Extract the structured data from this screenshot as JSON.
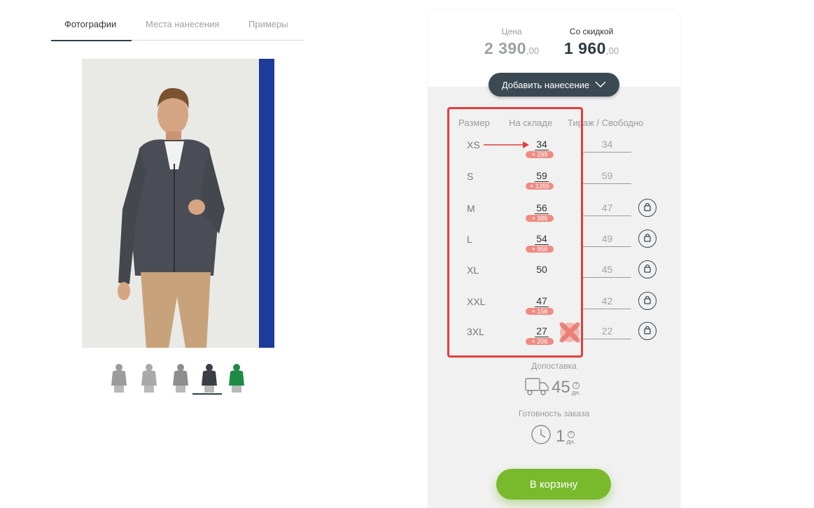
{
  "gallery": {
    "tabs": [
      {
        "label": "Фотографии",
        "active": true
      },
      {
        "label": "Места нанесения",
        "active": false
      },
      {
        "label": "Примеры",
        "active": false
      }
    ],
    "thumbnails": [
      {
        "color": "#9c9c9c",
        "active": false
      },
      {
        "color": "#a9a9a9",
        "active": false
      },
      {
        "color": "#8e8e8e",
        "active": false
      },
      {
        "color": "#3a3f47",
        "active": true
      },
      {
        "color": "#1f8a43",
        "active": false
      }
    ]
  },
  "prices": {
    "base_label": "Цена",
    "base_value": "2 390",
    "base_cents": ",00",
    "discount_label": "Со скидкой",
    "discount_value": "1 960",
    "discount_cents": ",00"
  },
  "add_print_button": {
    "label": "Добавить нанесение"
  },
  "table": {
    "headers": {
      "size": "Размер",
      "stock": "На складе",
      "qty": "Тираж / Свободно"
    },
    "rows": [
      {
        "size": "XS",
        "stock": "34",
        "extra": "+ 299",
        "qty": "34",
        "locked": false
      },
      {
        "size": "S",
        "stock": "59",
        "extra": "+ 1265",
        "qty": "59",
        "locked": false
      },
      {
        "size": "M",
        "stock": "56",
        "extra": "+ 386",
        "qty": "47",
        "locked": true
      },
      {
        "size": "L",
        "stock": "54",
        "extra": "+ 956",
        "qty": "49",
        "locked": true
      },
      {
        "size": "XL",
        "stock": "50",
        "extra": "",
        "qty": "45",
        "locked": true
      },
      {
        "size": "XXL",
        "stock": "47",
        "extra": "+ 156",
        "qty": "42",
        "locked": true
      },
      {
        "size": "3XL",
        "stock": "27",
        "extra": "+ 206",
        "qty": "22",
        "locked": true
      }
    ]
  },
  "delivery": {
    "label": "Допоставка",
    "value": "45",
    "unit": "дн."
  },
  "readiness": {
    "label": "Готовность заказа",
    "value": "1",
    "unit": "дн."
  },
  "cart_button": {
    "label": "В корзину"
  },
  "colors": {
    "accent_green": "#79b92c",
    "dark_button": "#3b4a52",
    "highlight_red": "#e33e3e",
    "badge_red": "#ee8c83"
  }
}
